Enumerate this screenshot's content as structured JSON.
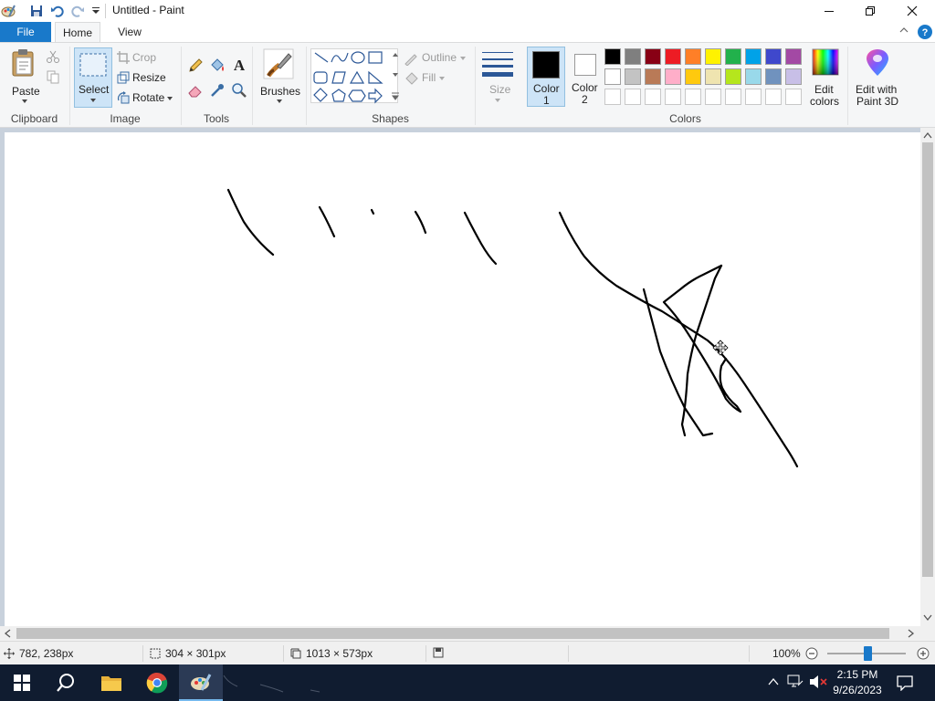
{
  "window": {
    "title": "Untitled - Paint",
    "tabs": {
      "file": "File",
      "home": "Home",
      "view": "View"
    }
  },
  "ribbon": {
    "clipboard": {
      "label": "Clipboard",
      "paste": "Paste"
    },
    "image": {
      "label": "Image",
      "select": "Select",
      "crop": "Crop",
      "resize": "Resize",
      "rotate": "Rotate"
    },
    "tools": {
      "label": "Tools"
    },
    "brushes": {
      "label": "Brushes"
    },
    "shapes": {
      "label": "Shapes",
      "outline": "Outline",
      "fill": "Fill"
    },
    "size": {
      "label": "Size"
    },
    "colors": {
      "label": "Colors",
      "color1": "Color",
      "color1_num": "1",
      "color2": "Color",
      "color2_num": "2",
      "edit_colors_line1": "Edit",
      "edit_colors_line2": "colors",
      "paint3d_line1": "Edit with",
      "paint3d_line2": "Paint 3D",
      "active_color1": "#000000",
      "active_color2": "#ffffff",
      "palette_row1": [
        "#000000",
        "#7f7f7f",
        "#880015",
        "#ed1c24",
        "#ff7f27",
        "#fff200",
        "#22b14c",
        "#00a2e8",
        "#3f48cc",
        "#a349a4"
      ],
      "palette_row2": [
        "#ffffff",
        "#c3c3c3",
        "#b97a57",
        "#ffaec9",
        "#ffc90e",
        "#efe4b0",
        "#b5e61d",
        "#99d9ea",
        "#7092be",
        "#c8bfe7"
      ]
    }
  },
  "status": {
    "cursor_pos": "782, 238px",
    "selection_size": "304 × 301px",
    "canvas_size": "1013 × 573px",
    "zoom": "100%"
  },
  "taskbar": {
    "time": "2:15 PM",
    "date": "9/26/2023"
  }
}
